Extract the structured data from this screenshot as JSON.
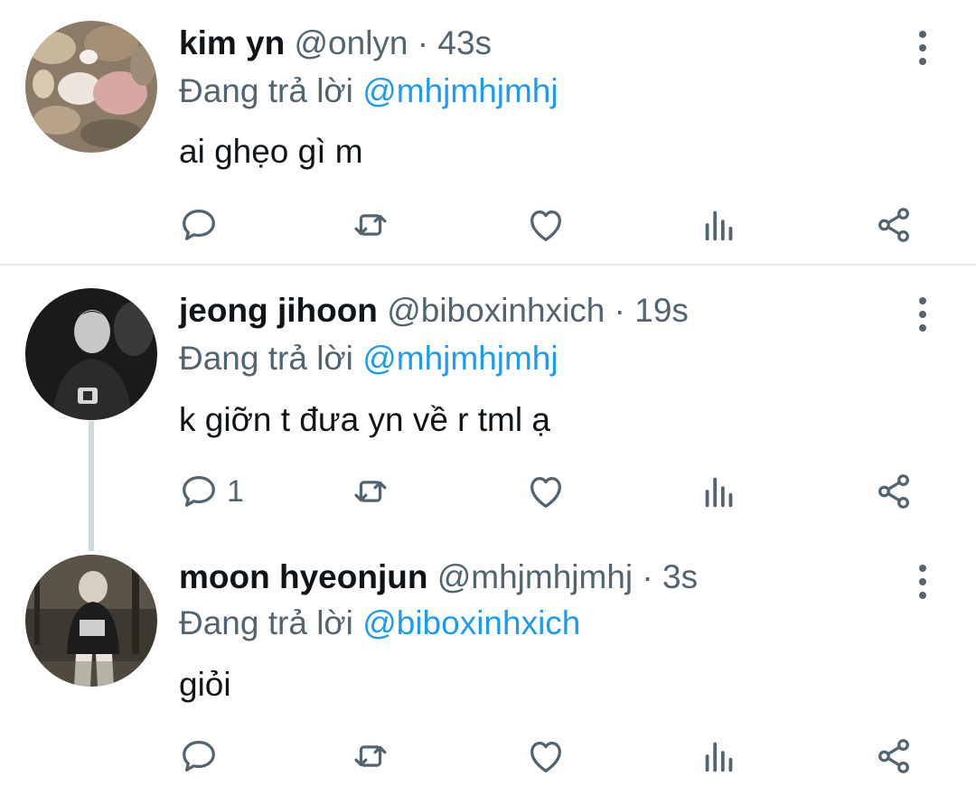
{
  "tweets": [
    {
      "name": "kim yn",
      "handle": "@onlyn",
      "time": "43s",
      "replying_prefix": "Đang trả lời",
      "replying_to": "@mhjmhjmhj",
      "text": "ai ghẹo gì m",
      "reply_count": ""
    },
    {
      "name": "jeong jihoon",
      "handle": "@biboxinhxich",
      "time": "19s",
      "replying_prefix": "Đang trả lời",
      "replying_to": "@mhjmhjmhj",
      "text": "k giỡn t đưa yn về r tml ạ",
      "reply_count": "1"
    },
    {
      "name": "moon hyeonjun",
      "handle": "@mhjmhjmhj",
      "time": "3s",
      "replying_prefix": "Đang trả lời",
      "replying_to": "@biboxinhxich",
      "text": "giỏi",
      "reply_count": ""
    }
  ],
  "separator": "·",
  "icons": [
    "reply-icon",
    "retweet-icon",
    "like-icon",
    "analytics-icon",
    "share-icon",
    "more-icon"
  ],
  "colors": {
    "text": "#0f1419",
    "muted": "#536471",
    "link": "#1d9bf0",
    "divider": "#e6e9ec"
  }
}
